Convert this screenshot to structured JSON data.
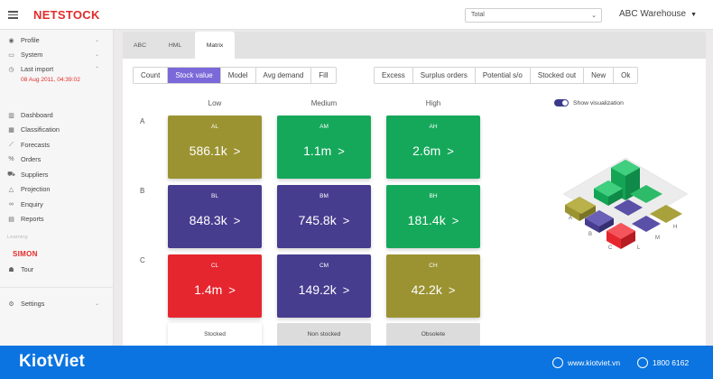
{
  "header": {
    "logo": "NETSTOCK",
    "select_value": "Total",
    "warehouse": "ABC Warehouse"
  },
  "sidebar": {
    "profile": "Profile",
    "system": "System",
    "last_import": "Last import",
    "last_import_date": "08 Aug 2011, 04:39:02",
    "dashboard": "Dashboard",
    "classification": "Classification",
    "forecasts": "Forecasts",
    "orders": "Orders",
    "suppliers": "Suppliers",
    "projection": "Projection",
    "enquiry": "Enquiry",
    "reports": "Reports",
    "learning": "Learning",
    "simon": "SIMON",
    "tour": "Tour",
    "settings": "Settings"
  },
  "tabs": {
    "abc": "ABC",
    "hml": "HML",
    "matrix": "Matrix"
  },
  "metrics": {
    "count": "Count",
    "stock_value": "Stock value",
    "model": "Model",
    "avg_demand": "Avg demand",
    "fill": "Fill"
  },
  "filters": {
    "excess": "Excess",
    "surplus": "Surplus orders",
    "potential": "Potential s/o",
    "stocked_out": "Stocked out",
    "new": "New",
    "ok": "Ok"
  },
  "toggle_label": "Show visualization",
  "columns": {
    "low": "Low",
    "medium": "Medium",
    "high": "High"
  },
  "rows": {
    "a": "A",
    "b": "B",
    "c": "C"
  },
  "tiles": {
    "al": {
      "code": "AL",
      "value": "586.1k"
    },
    "am": {
      "code": "AM",
      "value": "1.1m"
    },
    "ah": {
      "code": "AH",
      "value": "2.6m"
    },
    "bl": {
      "code": "BL",
      "value": "848.3k"
    },
    "bm": {
      "code": "BM",
      "value": "745.8k"
    },
    "bh": {
      "code": "BH",
      "value": "181.4k"
    },
    "cl": {
      "code": "CL",
      "value": "1.4m"
    },
    "cm": {
      "code": "CM",
      "value": "149.2k"
    },
    "ch": {
      "code": "CH",
      "value": "42.2k"
    }
  },
  "legend": {
    "stocked": "Stocked",
    "non_stocked": "Non stocked",
    "obsolete": "Obsolete"
  },
  "viz_labels": {
    "a": "A",
    "b": "B",
    "c": "C",
    "l": "L",
    "m": "M",
    "h": "H"
  },
  "colors": {
    "olive": "#9b9331",
    "green": "#16a85a",
    "purple": "#463d8f",
    "red": "#e5262f",
    "accent": "#7b68d9",
    "brand_red": "#e22b2b",
    "footer_blue": "#0b74e0"
  },
  "footer": {
    "brand": "KiotViet",
    "website": "www.kiotviet.vn",
    "phone": "1800 6162"
  }
}
